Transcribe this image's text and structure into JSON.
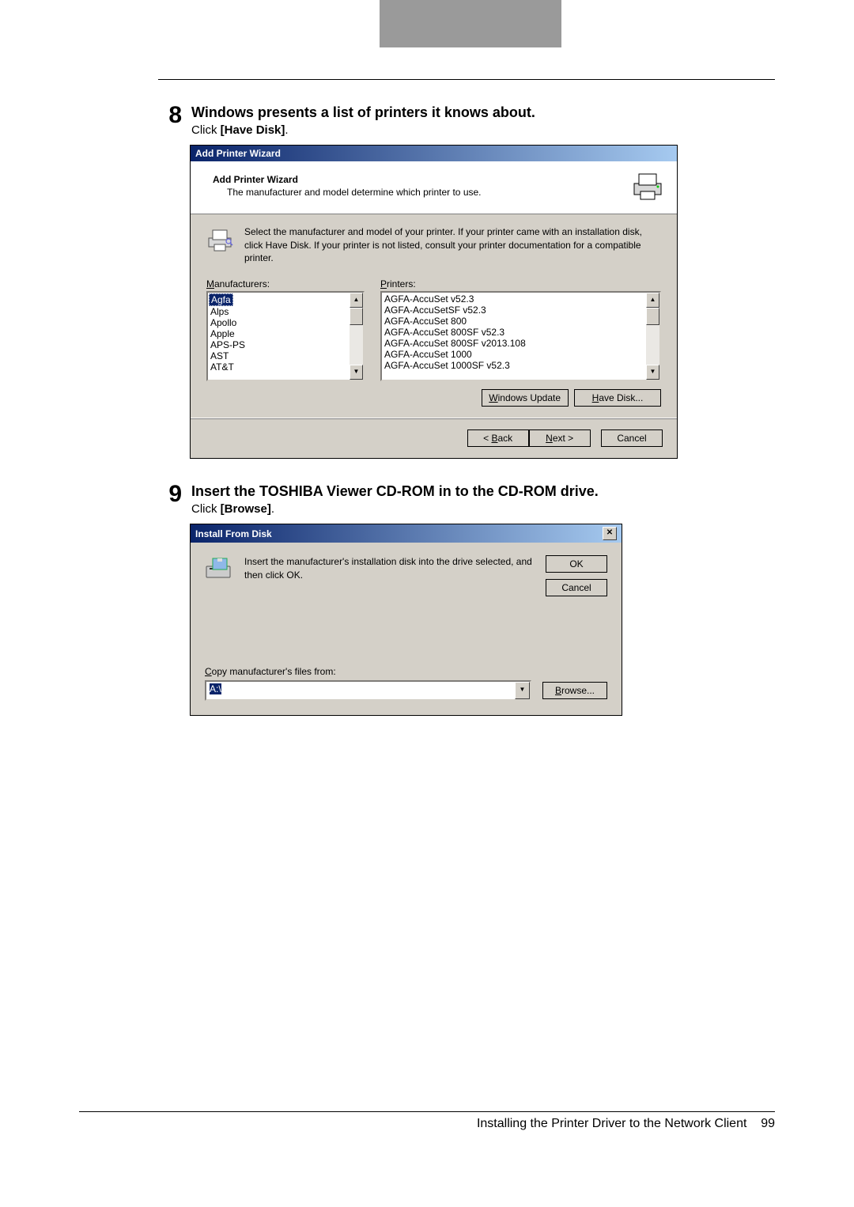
{
  "top_tab": "",
  "step8": {
    "num": "8",
    "title": "Windows presents a list of printers it knows about.",
    "sub_pre": "Click ",
    "sub_bold": "[Have Disk]",
    "sub_post": "."
  },
  "wizard": {
    "titlebar": "Add Printer Wizard",
    "header_title": "Add Printer Wizard",
    "header_sub": "The manufacturer and model determine which printer to use.",
    "body_text": "Select the manufacturer and model of your printer. If your printer came with an installation disk, click Have Disk. If your printer is not listed, consult your printer documentation for a compatible printer.",
    "mf_label": "Manufacturers:",
    "pr_label": "Printers:",
    "manufacturers": [
      "Agfa",
      "Alps",
      "Apollo",
      "Apple",
      "APS-PS",
      "AST",
      "AT&T"
    ],
    "printers": [
      "AGFA-AccuSet v52.3",
      "AGFA-AccuSetSF v52.3",
      "AGFA-AccuSet 800",
      "AGFA-AccuSet 800SF v52.3",
      "AGFA-AccuSet 800SF v2013.108",
      "AGFA-AccuSet 1000",
      "AGFA-AccuSet 1000SF v52.3"
    ],
    "btn_winupdate": "Windows Update",
    "btn_havedisk": "Have Disk...",
    "btn_back": "< Back",
    "btn_next": "Next >",
    "btn_cancel": "Cancel"
  },
  "step9": {
    "num": "9",
    "title": "Insert the TOSHIBA Viewer CD-ROM in to the CD-ROM drive.",
    "sub_pre": "Click ",
    "sub_bold": "[Browse]",
    "sub_post": "."
  },
  "install_disk": {
    "titlebar": "Install From Disk",
    "msg": "Insert the manufacturer's installation disk into the drive selected, and then click OK.",
    "btn_ok": "OK",
    "btn_cancel": "Cancel",
    "copy_label": "Copy manufacturer's files from:",
    "path_value": "A:\\",
    "btn_browse": "Browse..."
  },
  "footer": {
    "text": "Installing the Printer Driver to the Network Client",
    "page": "99"
  }
}
